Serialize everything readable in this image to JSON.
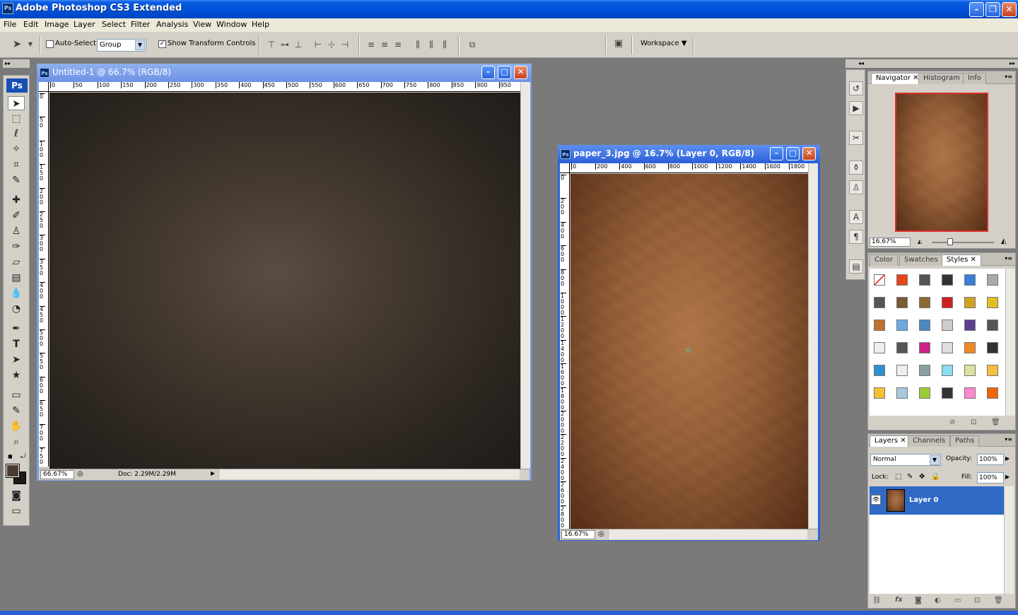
{
  "app": {
    "title": "Adobe Photoshop CS3 Extended",
    "icon": "ps-app-icon"
  },
  "menu": [
    "File",
    "Edit",
    "Image",
    "Layer",
    "Select",
    "Filter",
    "Analysis",
    "View",
    "Window",
    "Help"
  ],
  "options": {
    "auto_select_label": "Auto-Select:",
    "auto_select_checked": false,
    "auto_select_value": "Group",
    "show_transform_label": "Show Transform Controls",
    "show_transform_checked": true,
    "workspace_label": "Workspace"
  },
  "tools": {
    "ps_label": "Ps",
    "icons": [
      "move-icon",
      "marquee-icon",
      "lasso-icon",
      "magic-wand-icon",
      "crop-icon",
      "eyedropper-icon",
      "healing-icon",
      "brush-icon",
      "stamp-icon",
      "history-brush-icon",
      "eraser-icon",
      "gradient-icon",
      "blur-icon",
      "dodge-icon",
      "pen-icon",
      "type-icon",
      "path-select-icon",
      "shape-icon",
      "notes-icon",
      "eyedropper-icon",
      "hand-icon",
      "zoom-icon"
    ],
    "fg_color": "#4a3c32",
    "bg_color": "#1e1a16"
  },
  "doc1": {
    "title": "Untitled-1 @ 66.7% (RGB/8)",
    "ruler_h": [
      "0",
      "50",
      "100",
      "150",
      "200",
      "250",
      "300",
      "350",
      "400",
      "450",
      "500",
      "550",
      "600",
      "650",
      "700",
      "750",
      "800",
      "850",
      "900",
      "950"
    ],
    "ruler_v": [
      "0",
      "5 0",
      "1 0 0",
      "1 5 0",
      "2 0 0",
      "2 5 0",
      "3 0 0",
      "3 5 0",
      "4 0 0",
      "4 5 0",
      "5 0 0",
      "5 5 0",
      "6 0 0",
      "6 5 0",
      "7 0 0",
      "7 5 0"
    ],
    "zoom": "66.67%",
    "doc_info": "Doc: 2.29M/2.29M"
  },
  "doc2": {
    "title": "paper_3.jpg @ 16.7% (Layer 0, RGB/8)",
    "ruler_h": [
      "0",
      "200",
      "400",
      "600",
      "800",
      "1000",
      "1200",
      "1400",
      "1600",
      "1800"
    ],
    "ruler_v": [
      "0",
      "2 0 0",
      "4 0 0",
      "6 0 0",
      "8 0 0",
      "1 0 0 0",
      "1 2 0 0",
      "1 4 0 0",
      "1 6 0 0",
      "1 8 0 0",
      "2 0 0 0",
      "2 2 0 0",
      "2 4 0 0",
      "2 6 0 0",
      "2 8 0 0"
    ],
    "zoom": "16.67%"
  },
  "navigator": {
    "tabs": [
      "Navigator",
      "Histogram",
      "Info"
    ],
    "zoom": "16.67%"
  },
  "styles_panel": {
    "tabs": [
      "Color",
      "Swatches",
      "Styles"
    ],
    "swatch_colors": [
      "#ffffff",
      "#e8461a",
      "#555555",
      "#333333",
      "#3a7fd5",
      "#aaaaaa",
      "#555555",
      "#7a5a30",
      "#8a6a30",
      "#cc2222",
      "#d4a020",
      "#e0c020",
      "#c07030",
      "#6aaae0",
      "#4a88c0",
      "#cccccc",
      "#5a4090",
      "#555555",
      "#eeeeee",
      "#555555",
      "#cc2288",
      "#dddddd",
      "#ee8822",
      "#333333",
      "#2a90d0",
      "#eeeeee",
      "#8aa0a0",
      "#88ddee",
      "#dde0a0",
      "#f5c040",
      "#f5c030",
      "#a8c8e0",
      "#99cc33",
      "#333333",
      "#ff88cc",
      "#ee6600"
    ]
  },
  "layers_panel": {
    "tabs": [
      "Layers",
      "Channels",
      "Paths"
    ],
    "blend_mode": "Normal",
    "opacity_label": "Opacity:",
    "opacity": "100%",
    "lock_label": "Lock:",
    "fill_label": "Fill:",
    "fill": "100%",
    "layer_name": "Layer 0"
  }
}
